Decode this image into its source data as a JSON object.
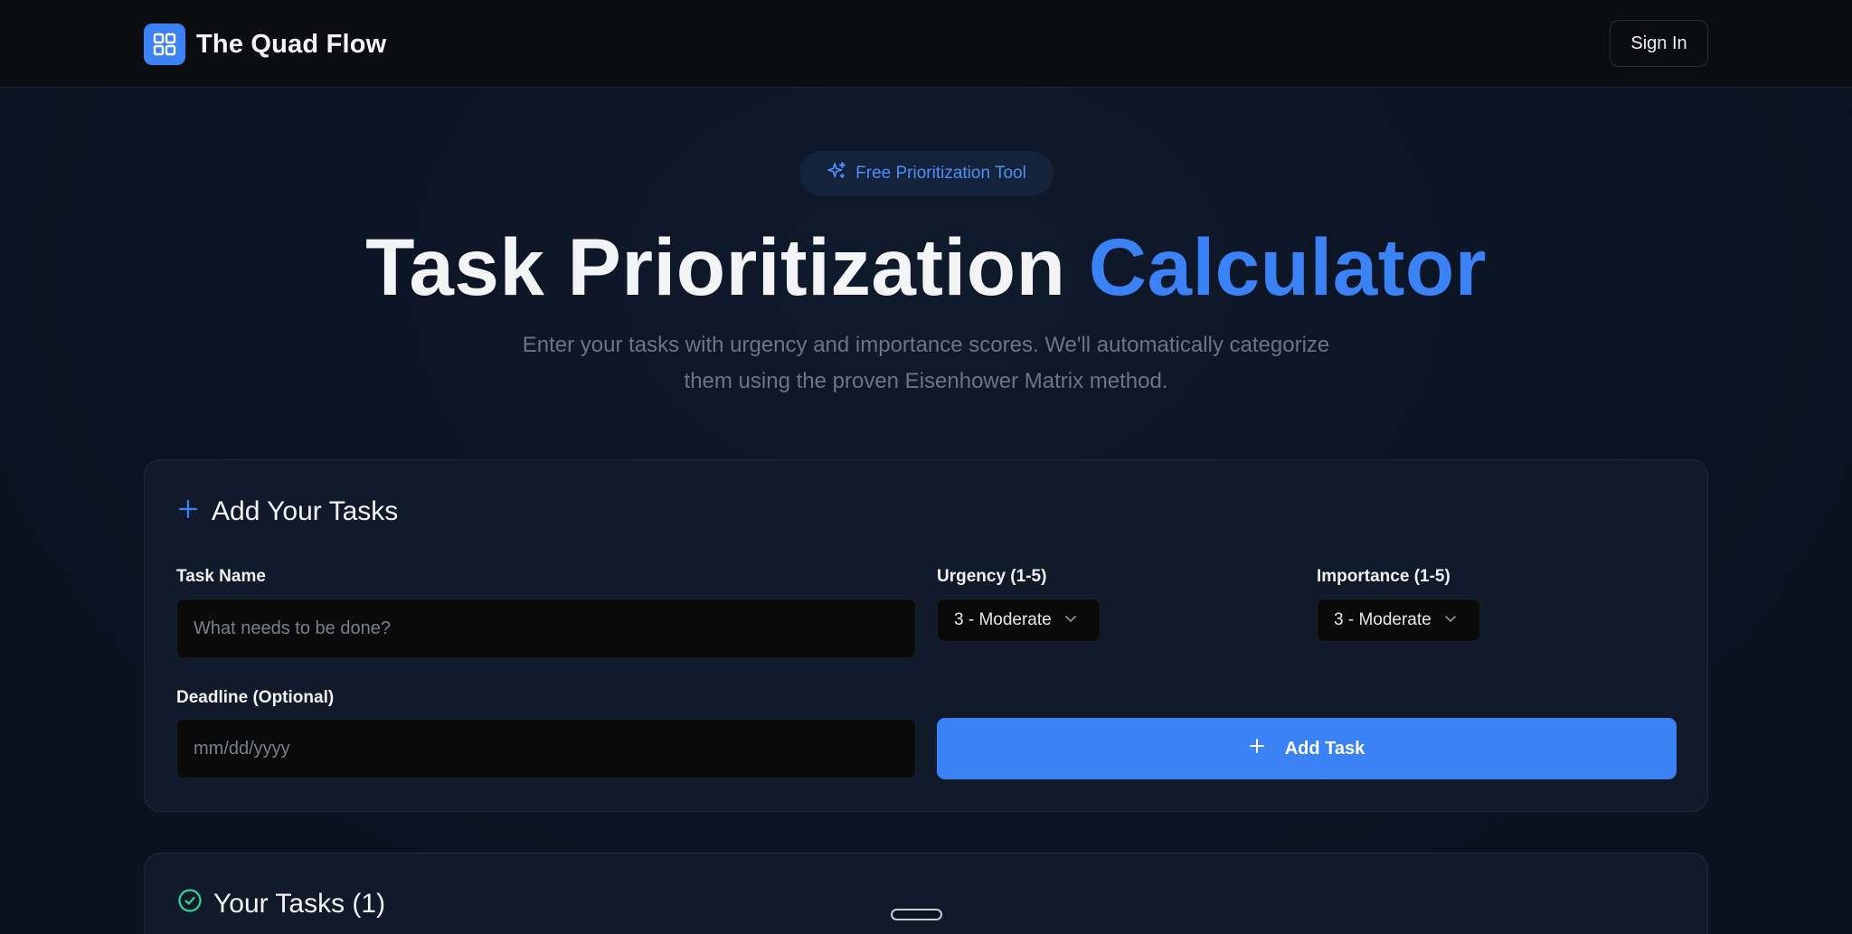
{
  "header": {
    "brand": "The Quad Flow",
    "sign_in": "Sign In"
  },
  "hero": {
    "badge": "Free Prioritization Tool",
    "title_main": "Task Prioritization",
    "title_accent": "Calculator",
    "subtitle_line1": "Enter your tasks with urgency and importance scores. We'll automatically categorize",
    "subtitle_line2": "them using the proven Eisenhower Matrix method."
  },
  "add_tasks": {
    "title": "Add Your Tasks",
    "task_name_label": "Task Name",
    "task_name_placeholder": "What needs to be done?",
    "urgency_label": "Urgency (1-5)",
    "urgency_value": "3 - Moderate",
    "importance_label": "Importance (1-5)",
    "importance_value": "3 - Moderate",
    "deadline_label": "Deadline (Optional)",
    "deadline_placeholder": "mm/dd/yyyy",
    "add_button": "Add Task"
  },
  "your_tasks": {
    "title": "Your Tasks (1)"
  },
  "colors": {
    "accent": "#3b82f6",
    "success": "#34d399"
  }
}
